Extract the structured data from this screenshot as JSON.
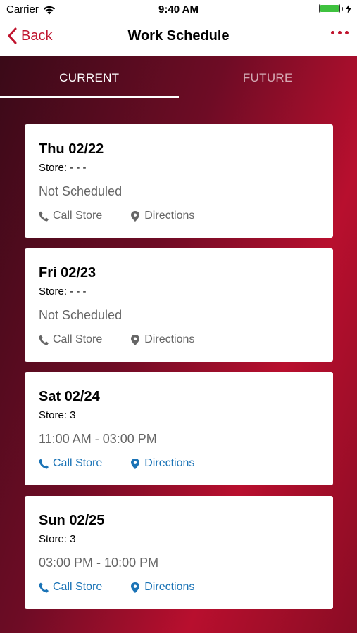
{
  "status_bar": {
    "carrier": "Carrier",
    "time": "9:40 AM"
  },
  "nav": {
    "back_label": "Back",
    "title": "Work Schedule"
  },
  "tabs": [
    {
      "label": "CURRENT",
      "active": true
    },
    {
      "label": "FUTURE",
      "active": false
    }
  ],
  "schedule": [
    {
      "day": "Thu 02/22",
      "store": "Store: - - -",
      "hours": "Not Scheduled",
      "call_label": "Call Store",
      "directions_label": "Directions",
      "actions_enabled": false
    },
    {
      "day": "Fri 02/23",
      "store": "Store: - - -",
      "hours": "Not Scheduled",
      "call_label": "Call Store",
      "directions_label": "Directions",
      "actions_enabled": false
    },
    {
      "day": "Sat 02/24",
      "store": "Store: 3",
      "hours": "11:00 AM - 03:00 PM",
      "call_label": "Call Store",
      "directions_label": "Directions",
      "actions_enabled": true
    },
    {
      "day": "Sun 02/25",
      "store": "Store: 3",
      "hours": "03:00 PM - 10:00 PM",
      "call_label": "Call Store",
      "directions_label": "Directions",
      "actions_enabled": true
    }
  ],
  "colors": {
    "brand": "#c0142e",
    "link": "#1a73b6",
    "muted": "#666666"
  },
  "icons": {
    "back": "chevron-left-icon",
    "more": "more-dots-icon",
    "call": "phone-icon",
    "directions": "map-pin-icon"
  }
}
